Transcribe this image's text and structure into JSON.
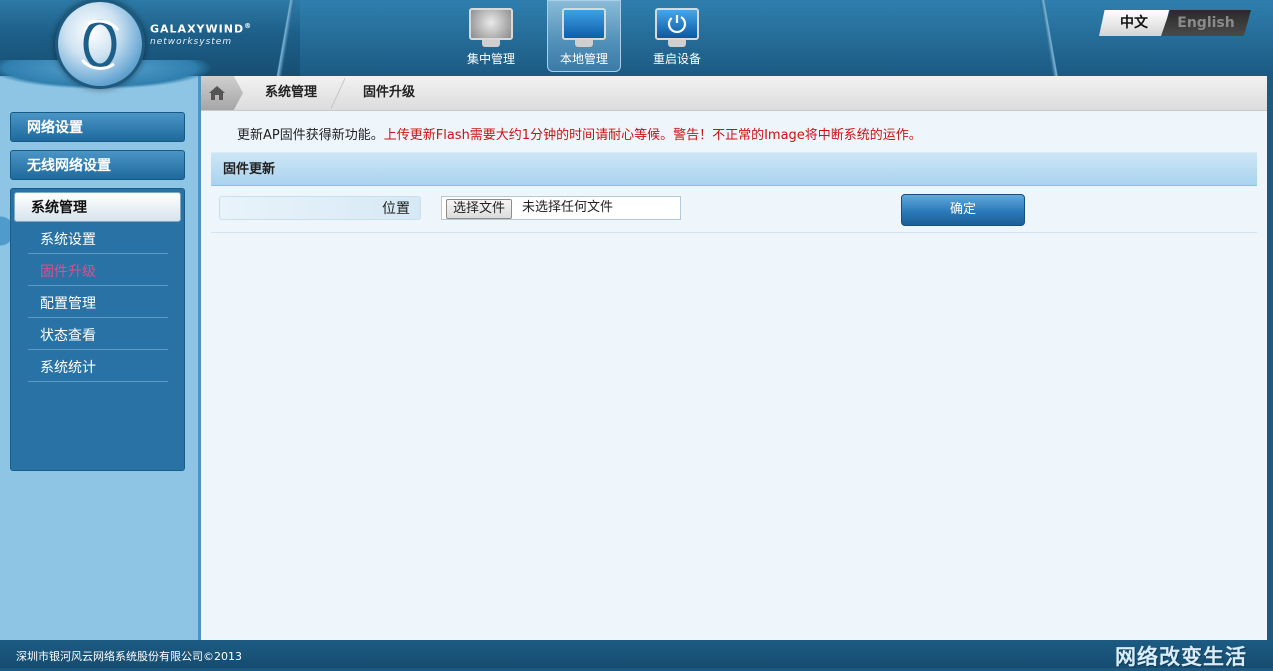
{
  "brand": {
    "name": "GALAXYWIND",
    "registered": "®",
    "tagline": "networksystem"
  },
  "topnav": [
    {
      "label": "集中管理",
      "icon": "monitor-disc-icon",
      "active": false
    },
    {
      "label": "本地管理",
      "icon": "monitor-gears-icon",
      "active": true
    },
    {
      "label": "重启设备",
      "icon": "monitor-power-icon",
      "active": false
    }
  ],
  "language": {
    "zh": "中文",
    "en": "English"
  },
  "sidebar": {
    "groups": [
      {
        "label": "网络设置"
      },
      {
        "label": "无线网络设置"
      },
      {
        "label": "系统管理"
      }
    ],
    "sub_items": [
      {
        "label": "系统设置"
      },
      {
        "label": "固件升级"
      },
      {
        "label": "配置管理"
      },
      {
        "label": "状态查看"
      },
      {
        "label": "系统统计"
      }
    ],
    "current": "固件升级"
  },
  "breadcrumb": {
    "level1": "系统管理",
    "level2": "固件升级"
  },
  "notice": {
    "normal": "更新AP固件获得新功能。",
    "warning": "上传更新Flash需要大约1分钟的时间请耐心等候。警告！不正常的Image将中断系统的运作。"
  },
  "section": {
    "title": "固件更新",
    "location_label": "位置",
    "file_button": "选择文件",
    "file_status": "未选择任何文件",
    "confirm_button": "确定"
  },
  "footer": {
    "copyright": "深圳市银河风云网络系统股份有限公司©2013",
    "slogan": "网络改变生活"
  },
  "colors": {
    "header_blue": "#1d5f88",
    "sidebar_light": "#8ec5e4",
    "current_item": "#d8508e",
    "warning_text": "#cc1111",
    "content_bg": "#eef6fc"
  }
}
